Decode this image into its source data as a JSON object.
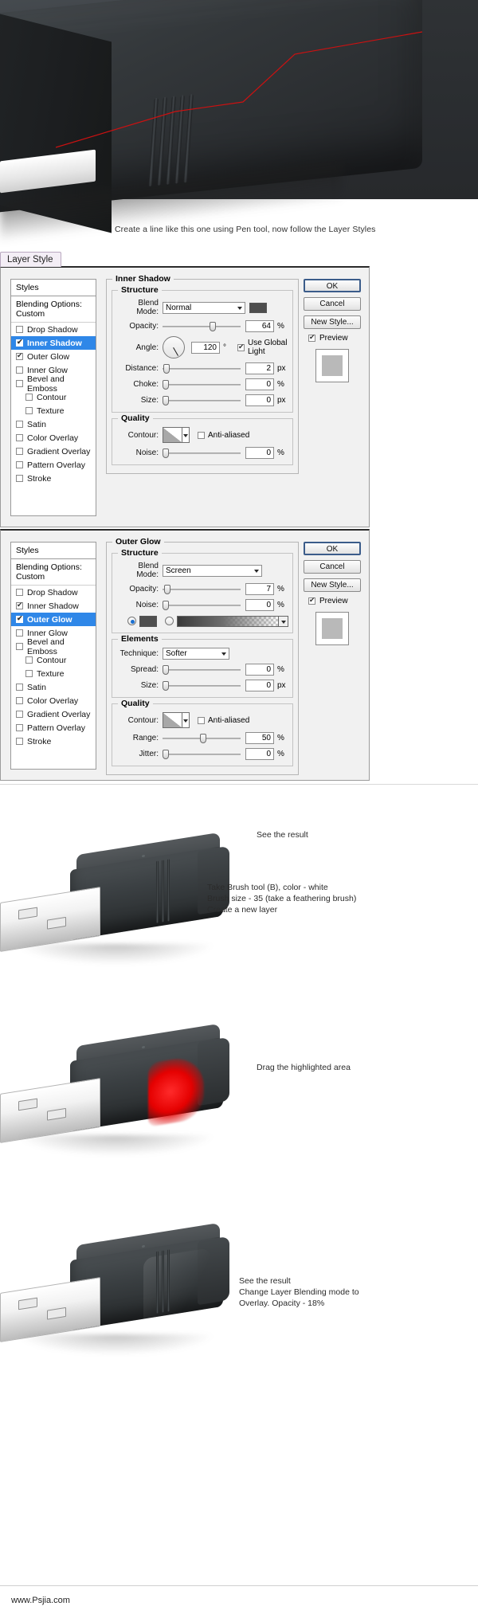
{
  "hero": {
    "caption": "Create a line like this one using Pen tool, now follow the Layer Styles"
  },
  "window": {
    "tab_title": "Layer Style"
  },
  "buttons": {
    "ok": "OK",
    "cancel": "Cancel",
    "new_style": "New Style...",
    "preview": "Preview"
  },
  "styles_panel": {
    "header": "Styles",
    "blending_options": "Blending Options: Custom",
    "items": [
      {
        "label": "Drop Shadow",
        "checked": false,
        "selected": false,
        "sub": false
      },
      {
        "label": "Inner Shadow",
        "checked": true,
        "selected": true,
        "sub": false
      },
      {
        "label": "Outer Glow",
        "checked": true,
        "selected": false,
        "sub": false
      },
      {
        "label": "Inner Glow",
        "checked": false,
        "selected": false,
        "sub": false
      },
      {
        "label": "Bevel and Emboss",
        "checked": false,
        "selected": false,
        "sub": false
      },
      {
        "label": "Contour",
        "checked": false,
        "selected": false,
        "sub": true
      },
      {
        "label": "Texture",
        "checked": false,
        "selected": false,
        "sub": true
      },
      {
        "label": "Satin",
        "checked": false,
        "selected": false,
        "sub": false
      },
      {
        "label": "Color Overlay",
        "checked": false,
        "selected": false,
        "sub": false
      },
      {
        "label": "Gradient Overlay",
        "checked": false,
        "selected": false,
        "sub": false
      },
      {
        "label": "Pattern Overlay",
        "checked": false,
        "selected": false,
        "sub": false
      },
      {
        "label": "Stroke",
        "checked": false,
        "selected": false,
        "sub": false
      }
    ],
    "items_2": [
      {
        "label": "Drop Shadow",
        "checked": false,
        "selected": false,
        "sub": false
      },
      {
        "label": "Inner Shadow",
        "checked": true,
        "selected": false,
        "sub": false
      },
      {
        "label": "Outer Glow",
        "checked": true,
        "selected": true,
        "sub": false
      },
      {
        "label": "Inner Glow",
        "checked": false,
        "selected": false,
        "sub": false
      },
      {
        "label": "Bevel and Emboss",
        "checked": false,
        "selected": false,
        "sub": false
      },
      {
        "label": "Contour",
        "checked": false,
        "selected": false,
        "sub": true
      },
      {
        "label": "Texture",
        "checked": false,
        "selected": false,
        "sub": true
      },
      {
        "label": "Satin",
        "checked": false,
        "selected": false,
        "sub": false
      },
      {
        "label": "Color Overlay",
        "checked": false,
        "selected": false,
        "sub": false
      },
      {
        "label": "Gradient Overlay",
        "checked": false,
        "selected": false,
        "sub": false
      },
      {
        "label": "Pattern Overlay",
        "checked": false,
        "selected": false,
        "sub": false
      },
      {
        "label": "Stroke",
        "checked": false,
        "selected": false,
        "sub": false
      }
    ]
  },
  "inner_shadow": {
    "title": "Inner Shadow",
    "structure_legend": "Structure",
    "blend_mode_label": "Blend Mode:",
    "blend_mode_value": "Normal",
    "shadow_color": "#4d4d4d",
    "opacity_label": "Opacity:",
    "opacity_value": "64",
    "opacity_unit": "%",
    "angle_label": "Angle:",
    "angle_value": "120",
    "angle_unit": "°",
    "use_global_light": "Use Global Light",
    "distance_label": "Distance:",
    "distance_value": "2",
    "distance_unit": "px",
    "choke_label": "Choke:",
    "choke_value": "0",
    "choke_unit": "%",
    "size_label": "Size:",
    "size_value": "0",
    "size_unit": "px",
    "quality_legend": "Quality",
    "contour_label": "Contour:",
    "anti_aliased": "Anti-aliased",
    "noise_label": "Noise:",
    "noise_value": "0",
    "noise_unit": "%"
  },
  "outer_glow": {
    "title": "Outer Glow",
    "structure_legend": "Structure",
    "blend_mode_label": "Blend Mode:",
    "blend_mode_value": "Screen",
    "opacity_label": "Opacity:",
    "opacity_value": "7",
    "opacity_unit": "%",
    "noise_label": "Noise:",
    "noise_value": "0",
    "noise_unit": "%",
    "glow_color": "#4f4f4f",
    "elements_legend": "Elements",
    "technique_label": "Technique:",
    "technique_value": "Softer",
    "spread_label": "Spread:",
    "spread_value": "0",
    "spread_unit": "%",
    "size_label": "Size:",
    "size_value": "0",
    "size_unit": "px",
    "quality_legend": "Quality",
    "contour_label": "Contour:",
    "anti_aliased": "Anti-aliased",
    "range_label": "Range:",
    "range_value": "50",
    "range_unit": "%",
    "jitter_label": "Jitter:",
    "jitter_value": "0",
    "jitter_unit": "%"
  },
  "results": {
    "note_1": "See the result",
    "note_2": "Take Brush tool (B), color - white\nBrush size - 35 (take a feathering brush)\nCreate a new layer",
    "note_3": "Drag the highlighted area",
    "note_4": "See the result\nChange Layer Blending mode to\nOverlay. Opacity - 18%"
  },
  "footer": {
    "site": "www.Psjia.com"
  },
  "colors": {
    "selection_blue": "#2f87e8",
    "glow_red": "#e50000",
    "dialog_bg": "#f1f1f1"
  }
}
